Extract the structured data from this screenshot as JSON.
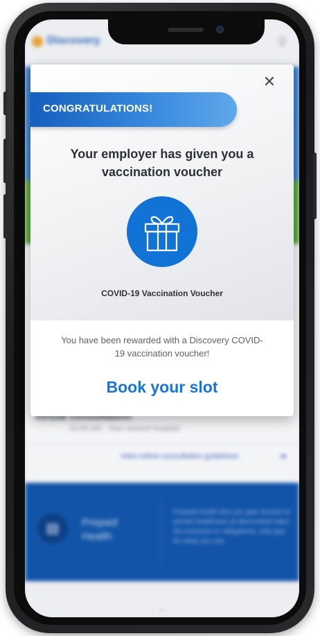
{
  "background_app": {
    "header_title": "Discovery",
    "search_icon": "search-icon",
    "appointment_title": "Virtual consultation",
    "appointment_subtitle": "15:00 AM · Your nearest hospital",
    "guidelines_link": "View online consultation guidelines",
    "prepaid_title": "Prepaid Health",
    "prepaid_description": "Prepaid health lets you gain access to private healthcare at discounted rates. No contracts or obligations, only pay for what you use."
  },
  "modal": {
    "close_icon": "close-icon",
    "banner_text": "CONGRATULATIONS!",
    "headline": "Your employer has given you a vaccination voucher",
    "gift_icon": "gift-icon",
    "voucher_label": "COVID-19 Vaccination Voucher",
    "reward_text": "You have been rewarded with a Discovery COVID-19 vaccination voucher!",
    "cta_label": "Book your slot"
  },
  "colors": {
    "accent_blue": "#1273d6",
    "banner_blue": "#1560bd",
    "cta_blue": "#1a73d6"
  }
}
